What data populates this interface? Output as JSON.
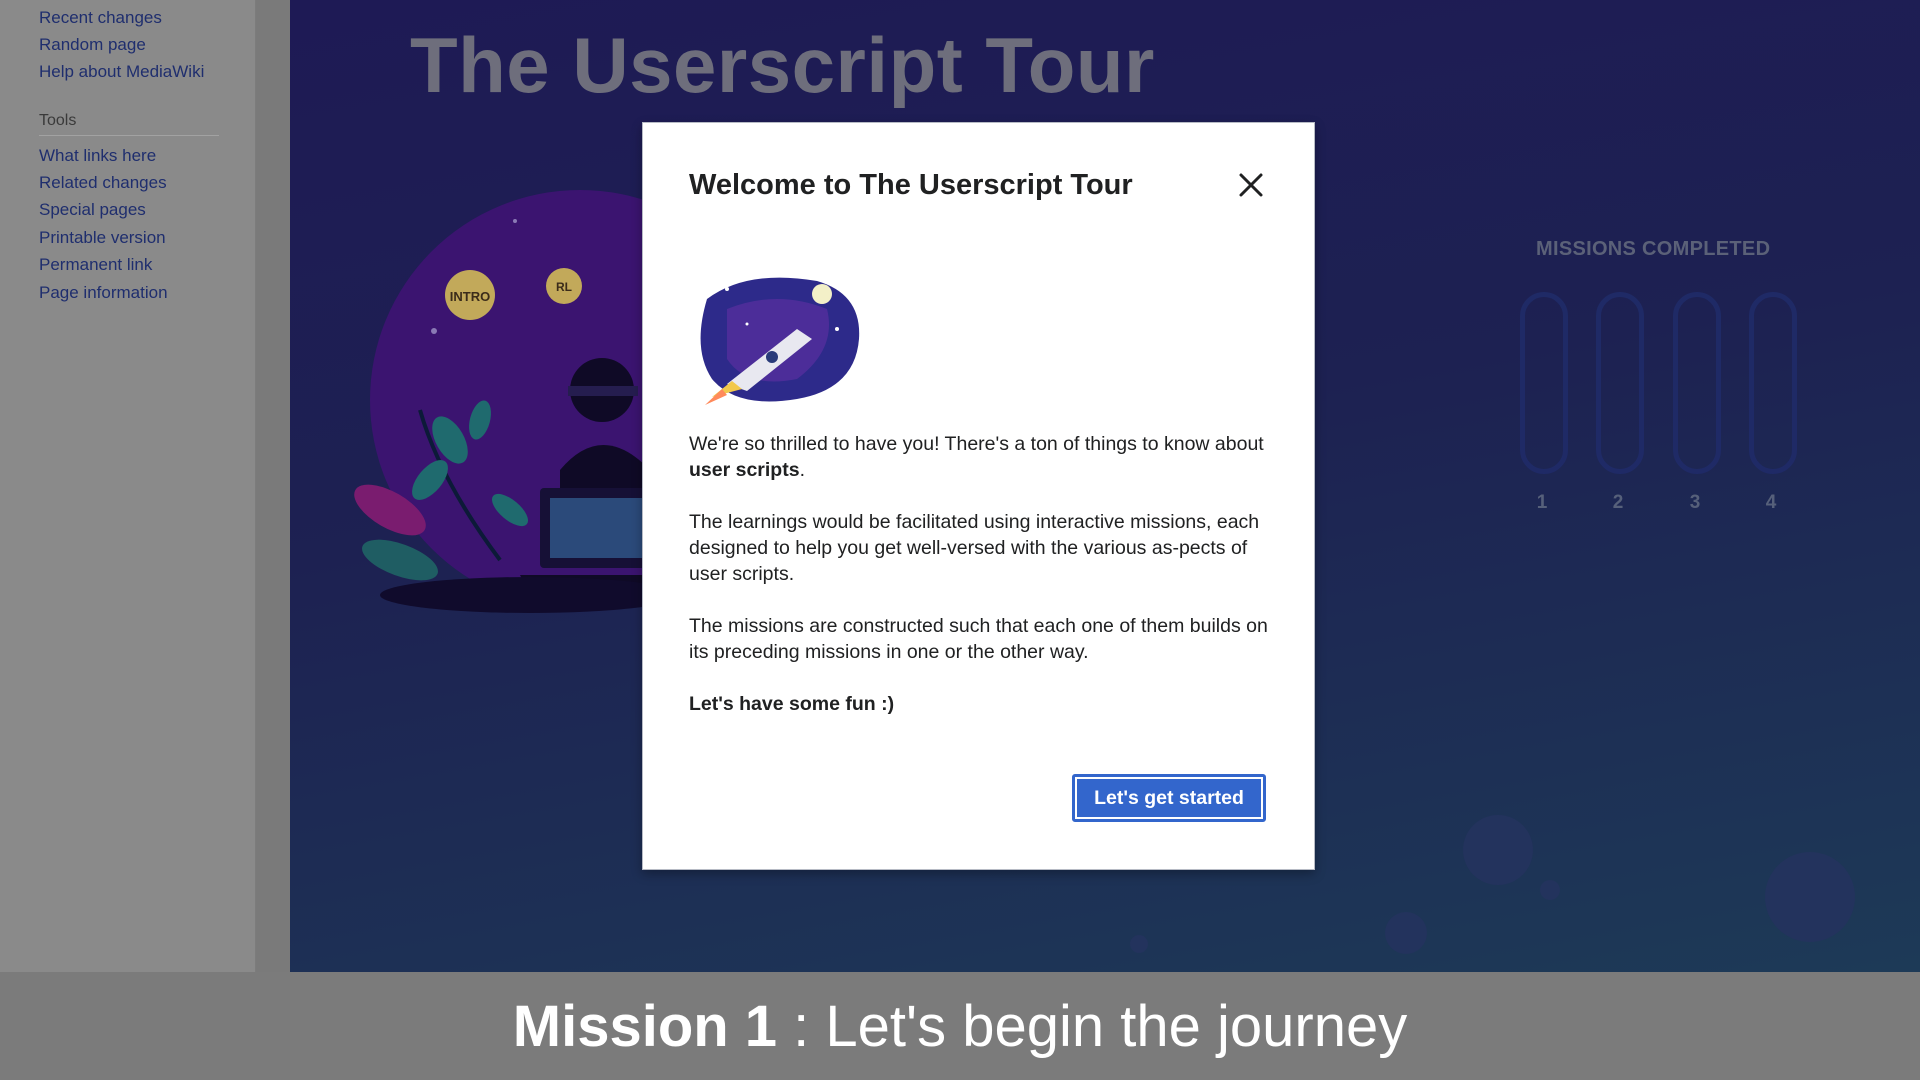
{
  "sidebar": {
    "navigation": [
      {
        "label": "Recent changes"
      },
      {
        "label": "Random page"
      },
      {
        "label": "Help about MediaWiki"
      }
    ],
    "tools_heading": "Tools",
    "tools": [
      {
        "label": "What links here"
      },
      {
        "label": "Related changes"
      },
      {
        "label": "Special pages"
      },
      {
        "label": "Printable version"
      },
      {
        "label": "Permanent link"
      },
      {
        "label": "Page information"
      }
    ]
  },
  "banner": {
    "title": "The Userscript Tour",
    "badges": [
      "INTRO",
      "RL"
    ],
    "missions_label": "MISSIONS COMPLETED",
    "missions_completed": 0,
    "missions": [
      "1",
      "2",
      "3",
      "4"
    ]
  },
  "dialog": {
    "title": "Welcome to The Userscript Tour",
    "para1_a": "We're so thrilled to have you! There's a ton of things to know about ",
    "para1_bold": "user scripts",
    "para1_b": ".",
    "para2": "The learnings would be facilitated using interactive missions, each designed to help you get well-versed with the various as-pects of user scripts.",
    "para3": "The missions are constructed such that each one of them builds on its preceding missions in one or the other way.",
    "para4": "Let's have some fun :)",
    "primary_button": "Let's get started"
  },
  "caption": {
    "bold": "Mission 1",
    "rest": " : Let's begin the journey"
  },
  "colors": {
    "banner_bg": "#1e1a55",
    "primary": "#3366cc",
    "link": "#1f2e6e"
  }
}
